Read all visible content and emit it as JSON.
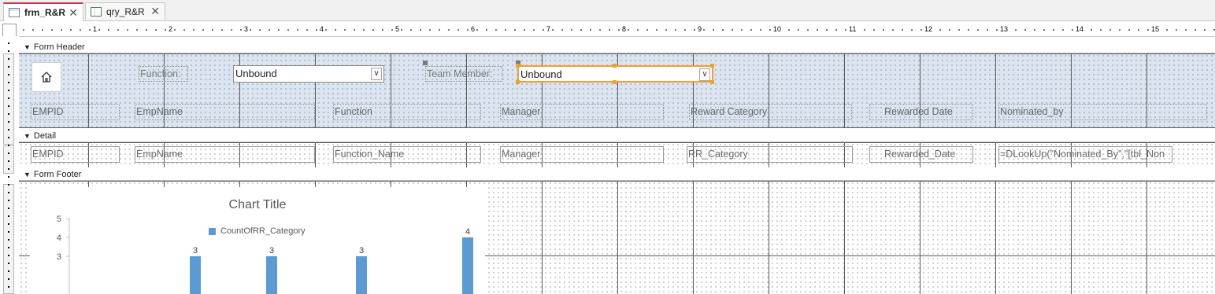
{
  "tabs": [
    {
      "label": "frm_R&R",
      "icon": "form-icon",
      "active": true
    },
    {
      "label": "qry_R&R",
      "icon": "query-icon",
      "active": false
    }
  ],
  "ruler": {
    "numbers": [
      "1",
      "2",
      "3",
      "4",
      "5",
      "6",
      "7",
      "8",
      "9",
      "10",
      "11",
      "12",
      "13",
      "14",
      "15"
    ]
  },
  "sections": {
    "form_header": "Form Header",
    "detail": "Detail",
    "form_footer": "Form Footer"
  },
  "header": {
    "function_label": "Function:",
    "function_combo_value": "Unbound",
    "team_member_label": "Team Member:",
    "team_member_combo_value": "Unbound",
    "column_labels": [
      "EMPID",
      "EmpName",
      "Function",
      "Manager",
      "Reward Category",
      "Rewarded Date",
      "Nominated_by"
    ]
  },
  "detail": {
    "fields": [
      "EMPID",
      "EmpName",
      "Function_Name",
      "Manager",
      "RR_Category",
      "Rewarded_Date",
      "=DLookUp(\"Nominated_By\",\"[tbl_Non"
    ]
  },
  "chart_data": {
    "type": "bar",
    "title": "Chart Title",
    "series": [
      {
        "name": "CountOfRR_Category",
        "values": [
          3,
          3,
          3,
          4
        ],
        "color": "#5b9bd5"
      }
    ],
    "y_ticks": [
      "5",
      "4",
      "3"
    ],
    "ylim": [
      0,
      5
    ],
    "data_labels": [
      "3",
      "3",
      "3",
      "4"
    ]
  }
}
